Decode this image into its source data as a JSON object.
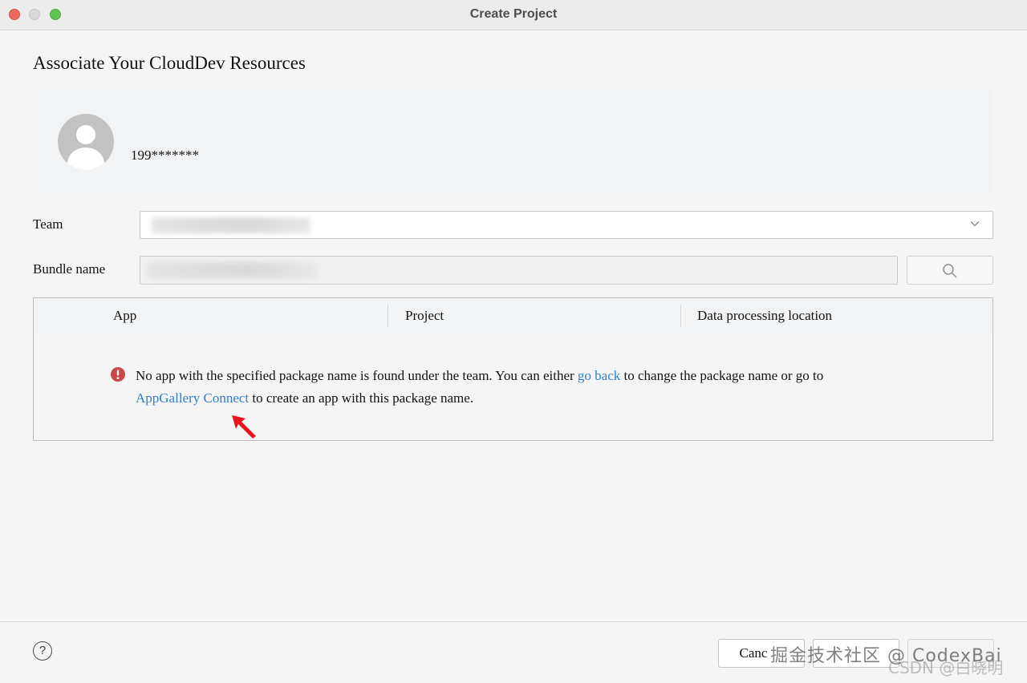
{
  "window": {
    "title": "Create Project"
  },
  "page": {
    "heading": "Associate Your CloudDev Resources"
  },
  "account": {
    "id": "199*******",
    "avatar_icon": "user-avatar-icon"
  },
  "form": {
    "team_label": "Team",
    "team_value": "",
    "bundle_label": "Bundle name",
    "bundle_value": ""
  },
  "table": {
    "columns": [
      "App",
      "Project",
      "Data processing location"
    ]
  },
  "message": {
    "part1": "No app with the specified package name is found under the team. You can either ",
    "link_go_back": "go back",
    "part2": " to change the package name or go to",
    "link_appgallery": "AppGallery Connect",
    "part3": " to create an app with this package name."
  },
  "footer": {
    "help": "?",
    "cancel": "Canc",
    "previous": "",
    "finish": ""
  },
  "watermark": {
    "line1": "掘金技术社区 @ CodexBai",
    "line2": "CSDN @白晓明"
  },
  "colors": {
    "link": "#2f7fd0",
    "error": "#c9474b",
    "arrow": "#e8141a"
  }
}
